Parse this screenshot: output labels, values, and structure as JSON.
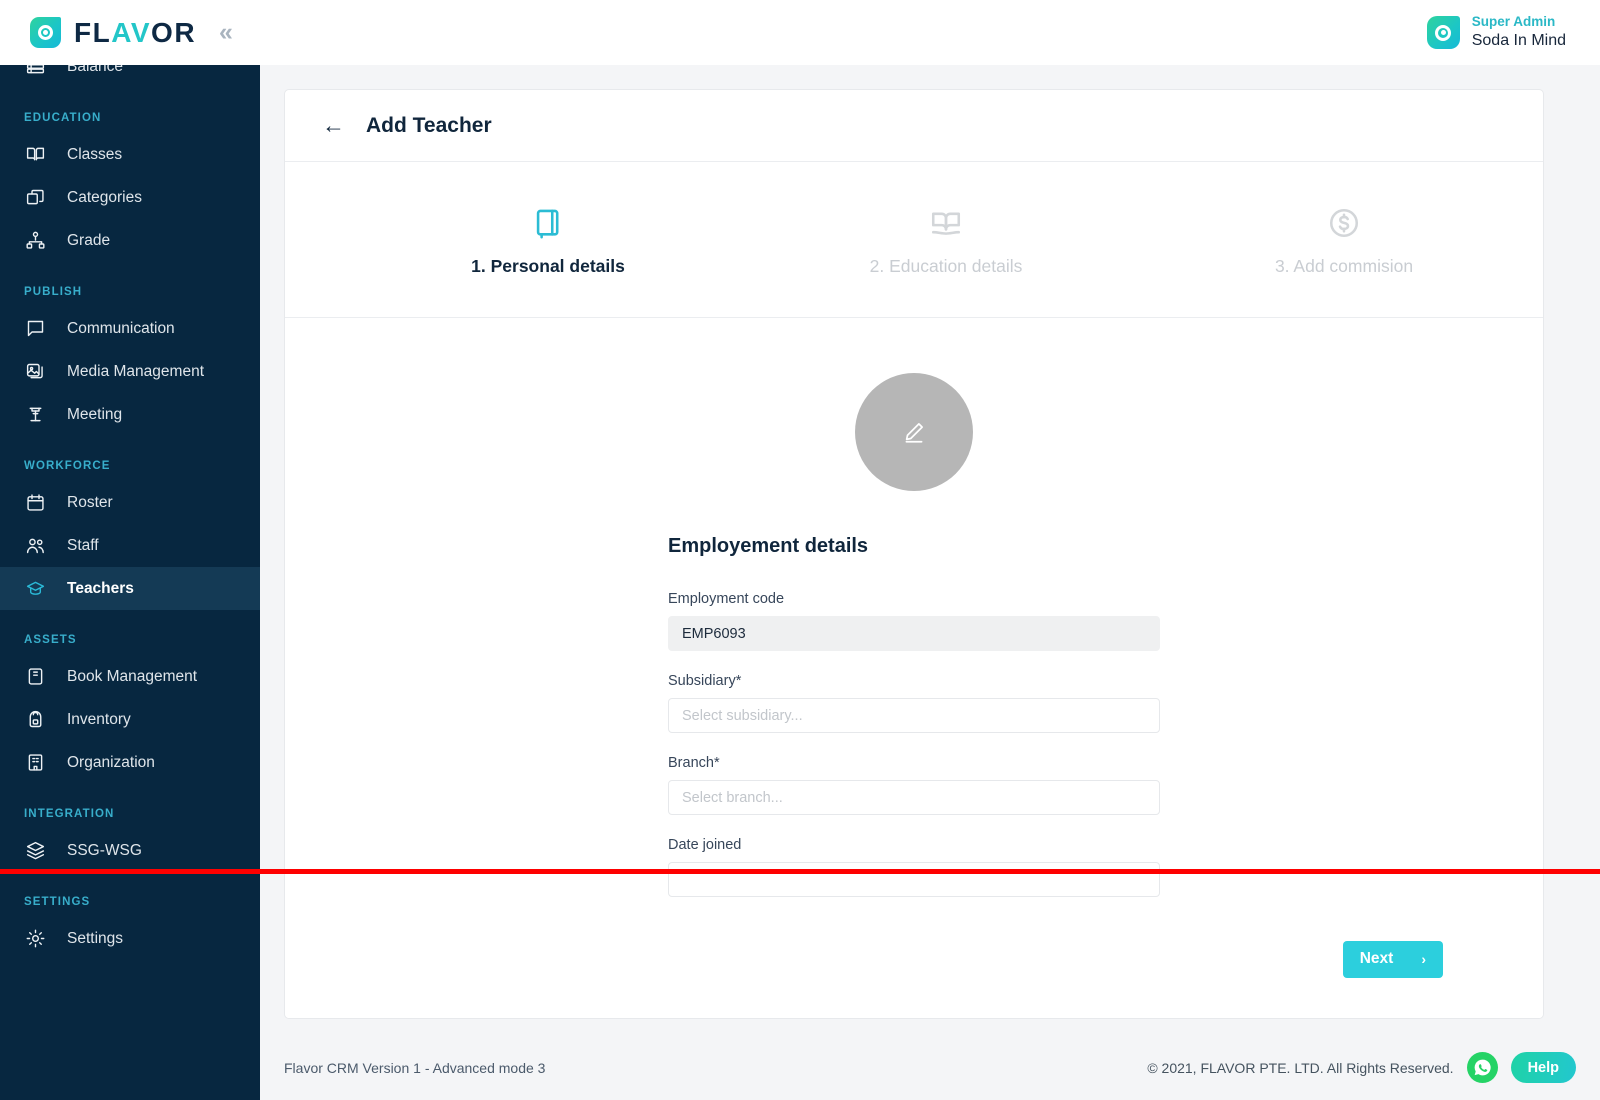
{
  "brand": {
    "name_main": "FL",
    "name_accent": "AV",
    "name_tail": "OR",
    "full": "FLAVOR",
    "collapse_glyph": "«"
  },
  "user": {
    "role": "Super Admin",
    "name": "Soda In Mind"
  },
  "sidebar": {
    "groups": [
      {
        "label": "",
        "items": [
          {
            "label": "Balance",
            "icon": "balance-icon",
            "active": false
          }
        ]
      },
      {
        "label": "EDUCATION",
        "items": [
          {
            "label": "Classes",
            "icon": "book-open-icon",
            "active": false
          },
          {
            "label": "Categories",
            "icon": "boxes-icon",
            "active": false
          },
          {
            "label": "Grade",
            "icon": "hierarchy-icon",
            "active": false
          }
        ]
      },
      {
        "label": "PUBLISH",
        "items": [
          {
            "label": "Communication",
            "icon": "chat-icon",
            "active": false
          },
          {
            "label": "Media Management",
            "icon": "image-stack-icon",
            "active": false
          },
          {
            "label": "Meeting",
            "icon": "podium-icon",
            "active": false
          }
        ]
      },
      {
        "label": "WORKFORCE",
        "items": [
          {
            "label": "Roster",
            "icon": "calendar-icon",
            "active": false
          },
          {
            "label": "Staff",
            "icon": "users-icon",
            "active": false
          },
          {
            "label": "Teachers",
            "icon": "graduation-cap-icon",
            "active": true
          }
        ]
      },
      {
        "label": "ASSETS",
        "items": [
          {
            "label": "Book Management",
            "icon": "book-closed-icon",
            "active": false
          },
          {
            "label": "Inventory",
            "icon": "backpack-icon",
            "active": false
          },
          {
            "label": "Organization",
            "icon": "building-icon",
            "active": false
          }
        ]
      },
      {
        "label": "INTEGRATION",
        "items": [
          {
            "label": "SSG-WSG",
            "icon": "layers-icon",
            "active": false
          }
        ]
      },
      {
        "label": "SETTINGS",
        "items": [
          {
            "label": "Settings",
            "icon": "gear-icon",
            "active": false
          }
        ]
      }
    ]
  },
  "page": {
    "title": "Add Teacher",
    "back_glyph": "←"
  },
  "stepper": {
    "steps": [
      {
        "label": "1. Personal details",
        "icon": "notebook-icon",
        "active": true
      },
      {
        "label": "2. Education details",
        "icon": "open-book-icon",
        "active": false
      },
      {
        "label": "3. Add commision",
        "icon": "dollar-circle-icon",
        "active": false
      }
    ]
  },
  "form": {
    "section_title": "Employement details",
    "fields": [
      {
        "label": "Employment code",
        "value": "EMP6093",
        "placeholder": "",
        "readonly": true,
        "name": "employment-code-input"
      },
      {
        "label": "Subsidiary*",
        "value": "",
        "placeholder": "Select subsidiary...",
        "readonly": false,
        "name": "subsidiary-select"
      },
      {
        "label": "Branch*",
        "value": "",
        "placeholder": "Select branch...",
        "readonly": false,
        "name": "branch-select"
      },
      {
        "label": "Date joined",
        "value": "",
        "placeholder": "",
        "readonly": false,
        "name": "date-joined-input"
      }
    ]
  },
  "actions": {
    "next_label": "Next",
    "next_chevron": "›"
  },
  "footer": {
    "version": "Flavor CRM Version 1 - Advanced mode 3",
    "copyright": "© 2021, FLAVOR PTE. LTD. All Rights Reserved.",
    "help_label": "Help"
  },
  "colors": {
    "sidebar_bg": "#072740",
    "sidebar_active": "#143a55",
    "section_label": "#38aecb",
    "accent_cyan": "#2ccfdd",
    "brand_teal": "#23c6c8",
    "whatsapp_green": "#25d366",
    "cutline_red": "#fe0000",
    "avatar_gray": "#b6b6b6"
  }
}
